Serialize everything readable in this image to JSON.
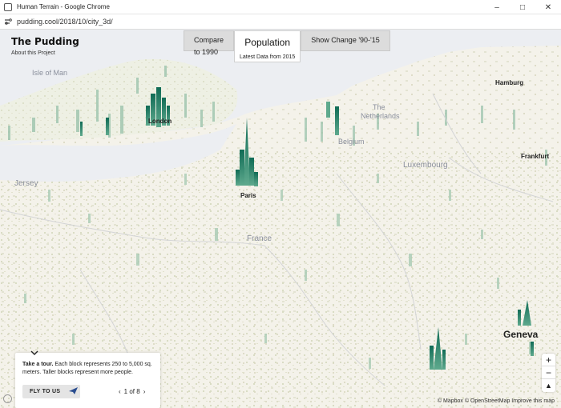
{
  "window": {
    "title": "Human Terrain - Google Chrome",
    "url": "pudding.cool/2018/10/city_3d/"
  },
  "brand": {
    "logo": "The Pudding",
    "about": "About this Project"
  },
  "tabs": {
    "compare_line1": "Compare",
    "compare_line2": "to 1990",
    "population": "Population",
    "population_sub": "Latest Data from 2015",
    "change": "Show Change '90-'15"
  },
  "places": {
    "isle_of_man": "Isle of Man",
    "london": "London",
    "the": "The",
    "netherlands": "Netherlands",
    "belgium": "Belgium",
    "hamburg": "Hamburg",
    "frankfurt": "Frankfurt",
    "luxembourg": "Luxembourg",
    "jersey": "Jersey",
    "paris": "Paris",
    "france": "France",
    "geneva": "Geneva"
  },
  "tour": {
    "heading": "Take a tour.",
    "body": " Each block represents 250 to 5,000 sq. meters. Taller blocks represent more people.",
    "fly_label": "FLY TO US",
    "pager": "1 of 8"
  },
  "zoom": {
    "in": "+",
    "out": "−",
    "compass": "▲"
  },
  "attribution": "© Mapbox © OpenStreetMap  Improve this map",
  "colors": {
    "land": "#f4f2ea",
    "water": "#e8eaee",
    "peak": "#1f7f66",
    "peak_light": "#78b09a"
  }
}
